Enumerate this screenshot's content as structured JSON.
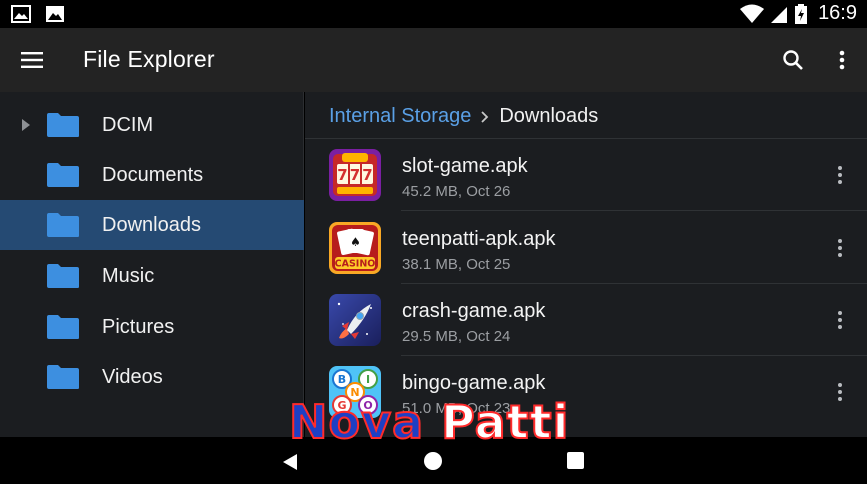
{
  "status_bar": {
    "time": "16:9",
    "left_icons": [
      "image-notification-icon",
      "photo-notification-icon"
    ],
    "right_icons": [
      "wifi-icon",
      "signal-icon",
      "battery-icon"
    ]
  },
  "app_bar": {
    "title": "File Explorer",
    "icons": [
      "menu-icon",
      "search-icon",
      "more-vert-icon"
    ]
  },
  "sidebar": {
    "items": [
      {
        "label": "DCIM",
        "expandable": true,
        "selected": false
      },
      {
        "label": "Documents",
        "expandable": false,
        "selected": false
      },
      {
        "label": "Downloads",
        "expandable": false,
        "selected": true
      },
      {
        "label": "Music",
        "expandable": false,
        "selected": false
      },
      {
        "label": "Pictures",
        "expandable": false,
        "selected": false
      },
      {
        "label": "Videos",
        "expandable": false,
        "selected": false
      }
    ]
  },
  "breadcrumb": {
    "root": "Internal Storage",
    "current": "Downloads"
  },
  "files": [
    {
      "name": "slot-game.apk",
      "meta": "45.2 MB, Oct 26",
      "icon": "slot-machine-icon"
    },
    {
      "name": "teenpatti-apk.apk",
      "meta": "38.1 MB, Oct 25",
      "icon": "casino-cards-icon",
      "icon_text": "CASINO"
    },
    {
      "name": "crash-game.apk",
      "meta": "29.5 MB, Oct 24",
      "icon": "rocket-icon"
    },
    {
      "name": "bingo-game.apk",
      "meta": "51.0 MB, Oct 23",
      "icon": "bingo-balls-icon",
      "icon_letters": [
        "B",
        "I",
        "N",
        "G",
        "O"
      ]
    }
  ],
  "watermark": {
    "word1": "Nova",
    "word2": "Patti"
  },
  "colors": {
    "app_bar": "#232323",
    "panel_bg": "#1b1d20",
    "selected_bg": "#254a73",
    "folder_blue": "#3d8fe0",
    "link_blue": "#5aa0e6"
  }
}
